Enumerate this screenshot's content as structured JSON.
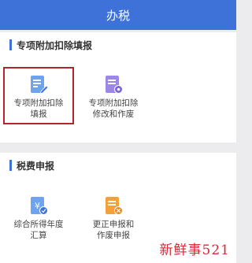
{
  "header": {
    "title": "办税"
  },
  "sections": [
    {
      "title": "专项附加扣除填报",
      "items": [
        {
          "line1": "专项附加扣除",
          "line2": "填报",
          "icon": "form-edit-icon",
          "color": "#6ea3ee"
        },
        {
          "line1": "专项附加扣除",
          "line2": "修改和作废",
          "icon": "form-settings-icon",
          "color": "#9c86e6"
        }
      ]
    },
    {
      "title": "税费申报",
      "items": [
        {
          "line1": "综合所得年度",
          "line2": "汇算",
          "icon": "tax-yuan-icon",
          "color": "#6ea3ee"
        },
        {
          "line1": "更正申报和",
          "line2": "作废申报",
          "icon": "correction-icon",
          "color": "#f3a23b"
        }
      ]
    }
  ],
  "watermark": "新鲜事521"
}
